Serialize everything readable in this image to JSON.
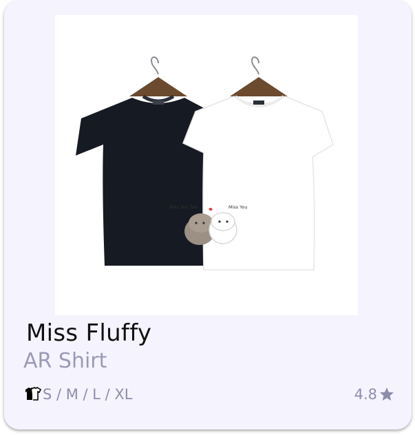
{
  "product": {
    "name": "Miss Fluffy",
    "category": "AR Shirt",
    "sizes": "S / M / L / XL",
    "rating": "4.8",
    "image_caption_left": "Miss You Too",
    "image_caption_right": "Miss You"
  },
  "icons": {
    "sizes_icon": "shirt-icon",
    "rating_icon": "star-icon"
  },
  "colors": {
    "card_background": "#f5f3fd",
    "title": "#111111",
    "muted": "#8e8eab",
    "black_shirt": "#161a22",
    "white_shirt": "#ffffff"
  }
}
